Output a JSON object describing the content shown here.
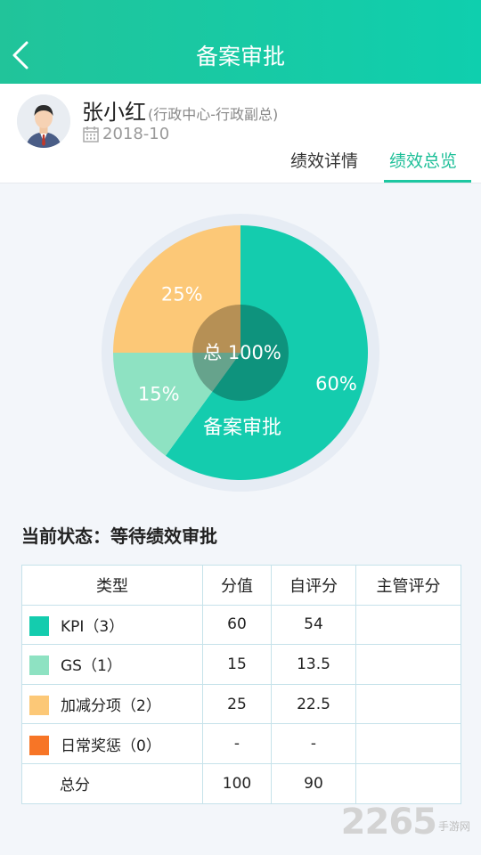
{
  "header": {
    "title": "备案审批",
    "back_icon": "chevron-left-icon"
  },
  "profile": {
    "name": "张小红",
    "department": "(行政中心-行政副总)",
    "date": "2018-10",
    "tabs": [
      {
        "label": "绩效详情",
        "active": false
      },
      {
        "label": "绩效总览",
        "active": true
      }
    ]
  },
  "chart_data": {
    "type": "pie",
    "title": "",
    "center_label": "总 100%",
    "slices": [
      {
        "name": "KPI",
        "value": 60,
        "label": "60%",
        "color": "#14ccae"
      },
      {
        "name": "GS",
        "value": 15,
        "label": "15%",
        "color": "#8ee2c2"
      },
      {
        "name": "加减分项",
        "value": 25,
        "label": "25%",
        "color": "#fcc877"
      }
    ],
    "overlay_label": "备案审批"
  },
  "status": {
    "text": "当前状态：等待绩效审批"
  },
  "table": {
    "headers": [
      "类型",
      "分值",
      "自评分",
      "主管评分"
    ],
    "rows": [
      {
        "type": "KPI（3）",
        "color": "#14ccae",
        "score": "60",
        "self": "54",
        "manager": ""
      },
      {
        "type": "GS（1）",
        "color": "#8ee2c2",
        "score": "15",
        "self": "13.5",
        "manager": ""
      },
      {
        "type": "加减分项（2）",
        "color": "#fcc877",
        "score": "25",
        "self": "22.5",
        "manager": ""
      },
      {
        "type": "日常奖惩（0）",
        "color": "#f77526",
        "score": "-",
        "self": "-",
        "manager": ""
      }
    ],
    "total": {
      "label": "总分",
      "score": "100",
      "self": "90",
      "manager": ""
    }
  },
  "watermark": {
    "number": "2265",
    "text": "手游网"
  }
}
